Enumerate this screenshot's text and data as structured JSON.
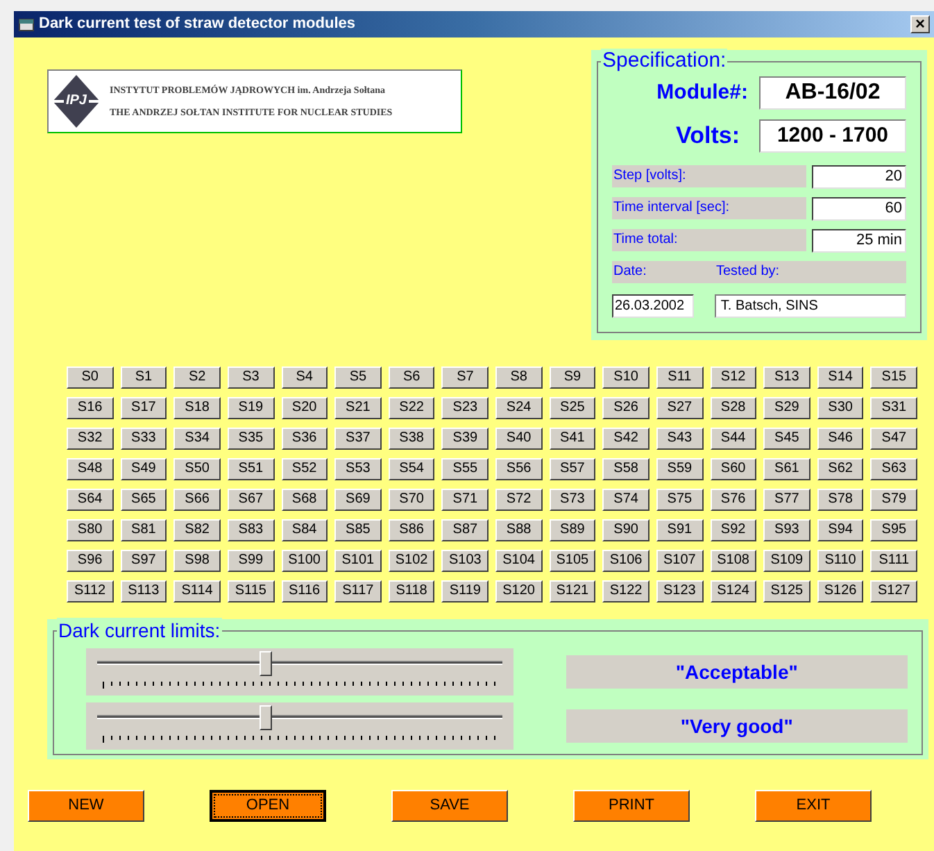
{
  "window": {
    "title": "Dark current test of straw detector modules",
    "close": "×"
  },
  "logo": {
    "mark": "IPJ",
    "line_1": "INSTYTUT PROBLEMÓW JĄDROWYCH im. Andrzeja Sołtana",
    "line_2": "THE ANDRZEJ SOŁTAN INSTITUTE FOR NUCLEAR STUDIES"
  },
  "specification": {
    "title": "Specification:",
    "module_label": "Module#:",
    "module_value": "AB-16/02",
    "volts_label": "Volts:",
    "volts_value": "1200 - 1700",
    "fields": [
      {
        "label": "Step [volts]:",
        "value": "20"
      },
      {
        "label": "Time interval [sec]:",
        "value": "60"
      },
      {
        "label": "Time total:",
        "value": "25 min"
      }
    ],
    "date_label": "Date:",
    "tested_by_label": "Tested by:",
    "date_value": "26.03.2002",
    "tested_by_value": "T. Batsch, SINS"
  },
  "sensors": [
    "S0",
    "S1",
    "S2",
    "S3",
    "S4",
    "S5",
    "S6",
    "S7",
    "S8",
    "S9",
    "S10",
    "S11",
    "S12",
    "S13",
    "S14",
    "S15",
    "S16",
    "S17",
    "S18",
    "S19",
    "S20",
    "S21",
    "S22",
    "S23",
    "S24",
    "S25",
    "S26",
    "S27",
    "S28",
    "S29",
    "S30",
    "S31",
    "S32",
    "S33",
    "S34",
    "S35",
    "S36",
    "S37",
    "S38",
    "S39",
    "S40",
    "S41",
    "S42",
    "S43",
    "S44",
    "S45",
    "S46",
    "S47",
    "S48",
    "S49",
    "S50",
    "S51",
    "S52",
    "S53",
    "S54",
    "S55",
    "S56",
    "S57",
    "S58",
    "S59",
    "S60",
    "S61",
    "S62",
    "S63",
    "S64",
    "S65",
    "S66",
    "S67",
    "S68",
    "S69",
    "S70",
    "S71",
    "S72",
    "S73",
    "S74",
    "S75",
    "S76",
    "S77",
    "S78",
    "S79",
    "S80",
    "S81",
    "S82",
    "S83",
    "S84",
    "S85",
    "S86",
    "S87",
    "S88",
    "S89",
    "S90",
    "S91",
    "S92",
    "S93",
    "S94",
    "S95",
    "S96",
    "S97",
    "S98",
    "S99",
    "S100",
    "S101",
    "S102",
    "S103",
    "S104",
    "S105",
    "S106",
    "S107",
    "S108",
    "S109",
    "S110",
    "S111",
    "S112",
    "S113",
    "S114",
    "S115",
    "S116",
    "S117",
    "S118",
    "S119",
    "S120",
    "S121",
    "S122",
    "S123",
    "S124",
    "S125",
    "S126",
    "S127"
  ],
  "limits": {
    "title": "Dark current limits:",
    "sliders": [
      {
        "level": 0.41,
        "label": "\"Acceptable\""
      },
      {
        "level": 0.41,
        "label": "\"Very good\""
      }
    ]
  },
  "buttons": [
    {
      "label": "NEW",
      "selected": false
    },
    {
      "label": "OPEN",
      "selected": true
    },
    {
      "label": "SAVE",
      "selected": false
    },
    {
      "label": "PRINT",
      "selected": false
    },
    {
      "label": "EXIT",
      "selected": false
    }
  ]
}
